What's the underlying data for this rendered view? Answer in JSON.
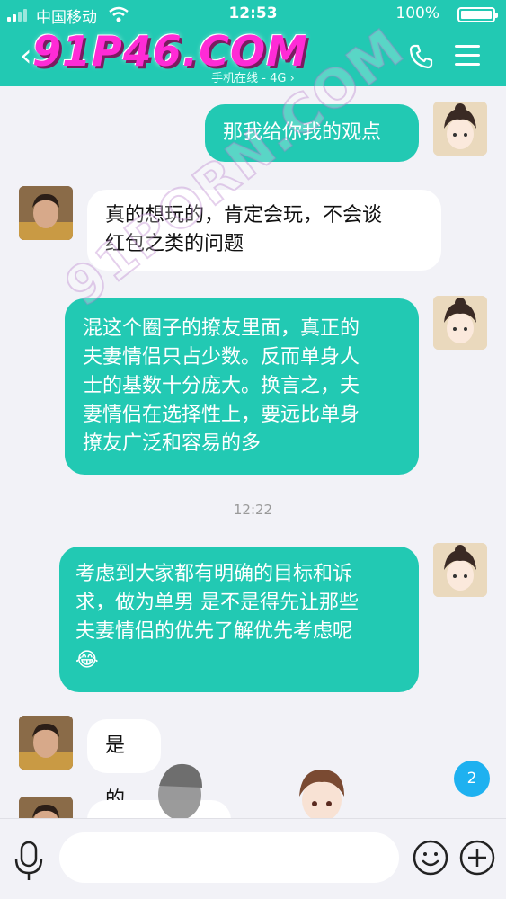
{
  "status_bar": {
    "carrier": "中国移动",
    "time": "12:53",
    "battery": "100%"
  },
  "header": {
    "back_label": "‹",
    "site_logo": "91P46.COM",
    "presence": "手机在线 - 4G ›"
  },
  "watermark": "91PORN.COM",
  "messages": [
    {
      "side": "out",
      "text": "那我给你我的观点"
    },
    {
      "side": "in",
      "lines": [
        "真的想玩的，肯定会玩，不会谈",
        "红包之类的问题"
      ]
    },
    {
      "side": "out",
      "lines": [
        "混这个圈子的撩友里面，真正的",
        "夫妻情侣只占少数。反而单身人",
        "士的基数十分庞大。换言之，夫",
        "妻情侣在选择性上，要远比单身",
        "撩友广泛和容易的多"
      ]
    },
    {
      "type": "timestamp",
      "text": "12:22"
    },
    {
      "side": "out",
      "lines": [
        "考虑到大家都有明确的目标和诉",
        "求，做为单男 是不是得先让那些",
        "夫妻情侣的优先了解优先考虑呢"
      ],
      "emoji": "😂"
    },
    {
      "side": "in",
      "text": "是的"
    }
  ],
  "unread_count": "2",
  "input": {
    "placeholder": ""
  },
  "colors": {
    "brand": "#22c9b3",
    "badge": "#1eb1f0",
    "background": "#f2f2f7"
  }
}
